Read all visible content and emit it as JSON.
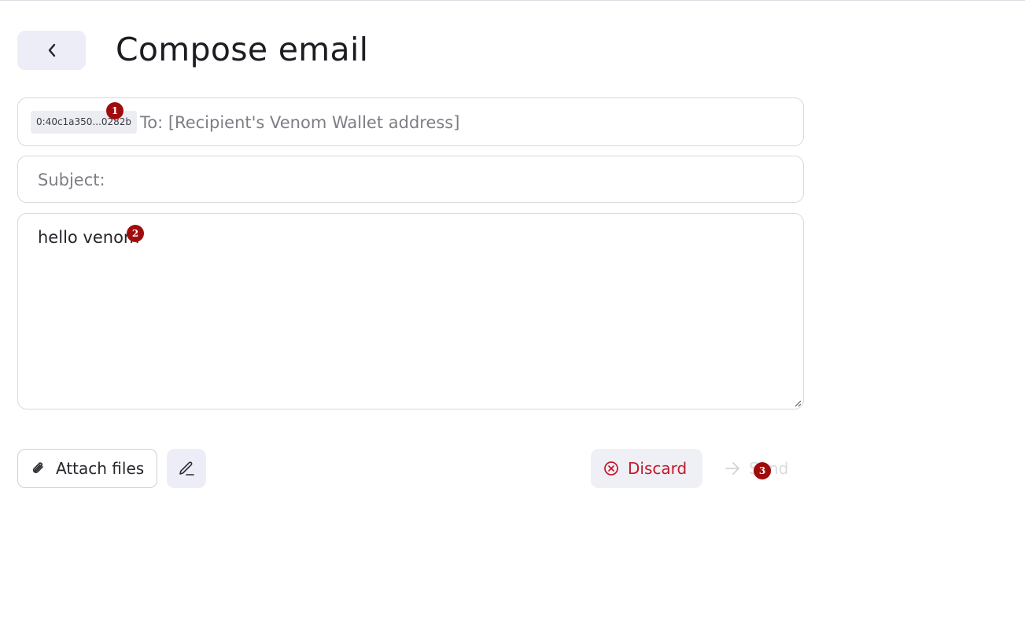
{
  "header": {
    "title": "Compose email",
    "back_icon": "chevron-left-icon"
  },
  "compose": {
    "to": {
      "chip_label": "0:40c1a350...0282b",
      "placeholder": "To: [Recipient's Venom Wallet address]"
    },
    "subject": {
      "placeholder": "Subject:",
      "value": ""
    },
    "body": {
      "value": "hello venom"
    }
  },
  "actions": {
    "attach_label": "Attach files",
    "attach_icon": "paperclip-icon",
    "sign_icon": "pen-icon",
    "discard_label": "Discard",
    "discard_icon": "close-circle-icon",
    "send_label": "Send",
    "send_icon": "arrow-right-icon"
  },
  "markers": [
    "1",
    "2",
    "3"
  ],
  "colors": {
    "accent_bg": "#ededf7",
    "danger": "#c0192a",
    "marker": "#a00c0c",
    "disabled_text": "#dadadf"
  }
}
